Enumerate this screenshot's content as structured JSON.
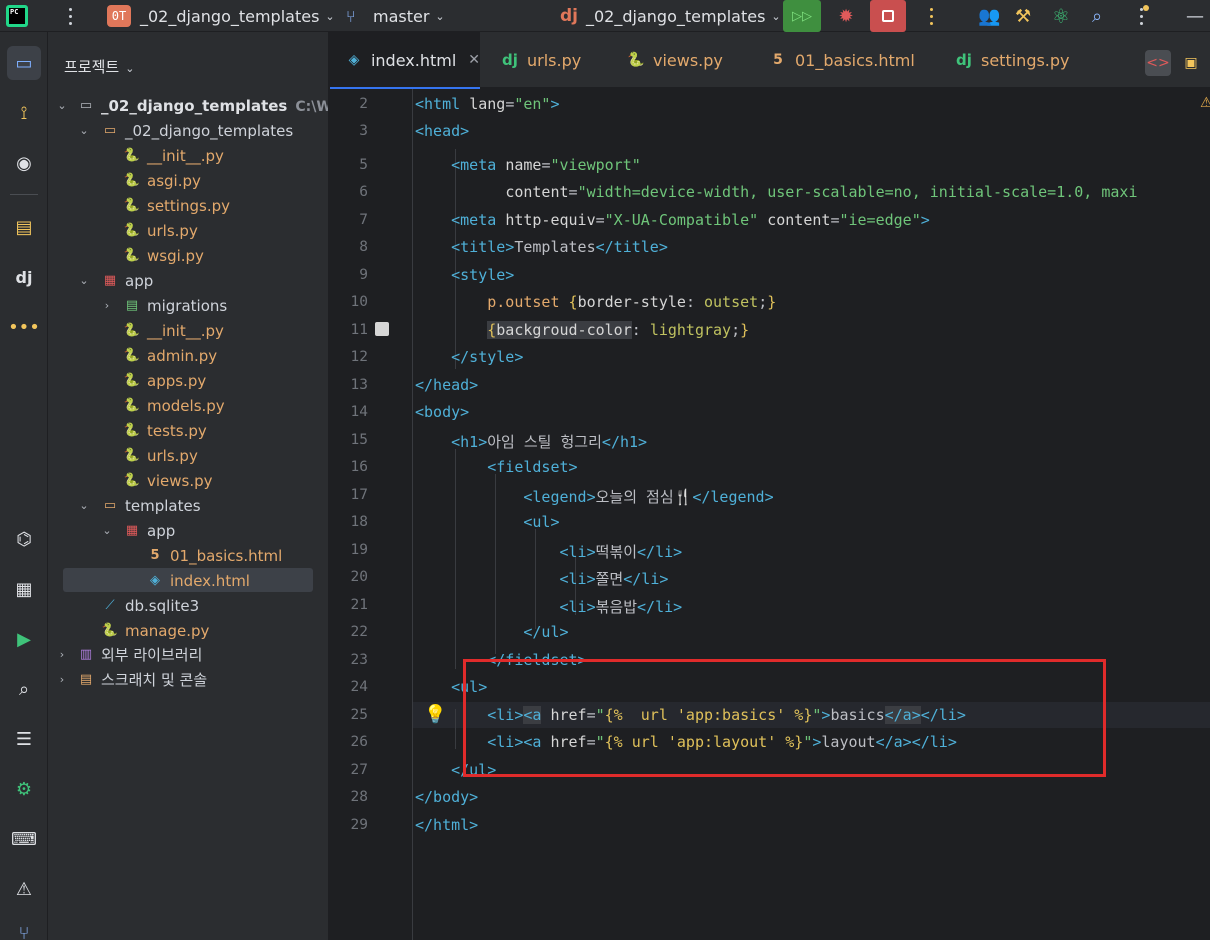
{
  "toolbar": {
    "logo_text": "PC",
    "project_badge": "0T",
    "project_name": "_02_django_templates",
    "branch": "master",
    "run_config_icon": "dj",
    "run_config": "_02_django_templates",
    "icons": [
      "hamburger-icon",
      "branch-icon",
      "run-icon",
      "debug-icon",
      "stop-icon",
      "people-icon",
      "tools-icon",
      "atom-icon",
      "search-icon",
      "more-icon",
      "close-icon"
    ]
  },
  "project_panel": {
    "title": "프로젝트",
    "root_name": "_02_django_templates",
    "root_path": "C:\\Wo",
    "tree": [
      {
        "label": "_02_django_templates",
        "kind": "folder"
      },
      {
        "label": "__init__.py",
        "kind": "py"
      },
      {
        "label": "asgi.py",
        "kind": "py"
      },
      {
        "label": "settings.py",
        "kind": "py"
      },
      {
        "label": "urls.py",
        "kind": "py"
      },
      {
        "label": "wsgi.py",
        "kind": "py"
      },
      {
        "label": "app",
        "kind": "module"
      },
      {
        "label": "migrations",
        "kind": "folder"
      },
      {
        "label": "__init__.py",
        "kind": "py"
      },
      {
        "label": "admin.py",
        "kind": "py"
      },
      {
        "label": "apps.py",
        "kind": "py"
      },
      {
        "label": "models.py",
        "kind": "py"
      },
      {
        "label": "tests.py",
        "kind": "py"
      },
      {
        "label": "urls.py",
        "kind": "py"
      },
      {
        "label": "views.py",
        "kind": "py"
      },
      {
        "label": "templates",
        "kind": "folder"
      },
      {
        "label": "app",
        "kind": "module"
      },
      {
        "label": "01_basics.html",
        "kind": "html"
      },
      {
        "label": "index.html",
        "kind": "html"
      },
      {
        "label": "db.sqlite3",
        "kind": "db"
      },
      {
        "label": "manage.py",
        "kind": "py"
      },
      {
        "label": "외부 라이브러리",
        "kind": "lib"
      },
      {
        "label": "스크래치 및 콘솔",
        "kind": "scratch"
      }
    ]
  },
  "tabs": [
    {
      "label": "index.html",
      "icon": "html-icon",
      "active": true
    },
    {
      "label": "urls.py",
      "icon": "dj",
      "active": false
    },
    {
      "label": "views.py",
      "icon": "python-icon",
      "active": false
    },
    {
      "label": "01_basics.html",
      "icon": "html5-icon",
      "active": false
    },
    {
      "label": "settings.py",
      "icon": "dj",
      "active": false
    }
  ],
  "editor": {
    "line_numbers": [
      "2",
      "3",
      "5",
      "6",
      "7",
      "8",
      "9",
      "10",
      "11",
      "12",
      "13",
      "14",
      "15",
      "16",
      "17",
      "18",
      "19",
      "20",
      "21",
      "22",
      "23",
      "24",
      "25",
      "26",
      "27",
      "28",
      "29"
    ],
    "code": {
      "l2_lang": "\"en\"",
      "l5_name": "\"viewport\"",
      "l6_content": "\"width=device-width, user-scalable=no, initial-scale=1.0, maxi",
      "l7_equiv": "\"X-UA-Compatible\"",
      "l7_content": "\"ie=edge\"",
      "l8_title": "Templates",
      "l10_selector": "p.outset",
      "l10_prop": "border-style",
      "l10_val": "outset",
      "l11_prop": "backgroud-color",
      "l11_val": "lightgray",
      "l15_h1": "아임 스틸 헝그리",
      "l17_legend": "오늘의 점심🍴",
      "l19_li": "떡볶이",
      "l20_li": "쫄면",
      "l21_li": "볶음밥",
      "l25_href": "{%  url 'app:basics' %}",
      "l25_text": "basics",
      "l26_href": "{% url 'app:layout' %}",
      "l26_text": "layout"
    }
  },
  "colors": {
    "accent": "#3574f0",
    "highlight_box": "#e02b2b",
    "python_file": "#e3a96c",
    "tag": "#4fb0d8",
    "string": "#6fc57a"
  }
}
